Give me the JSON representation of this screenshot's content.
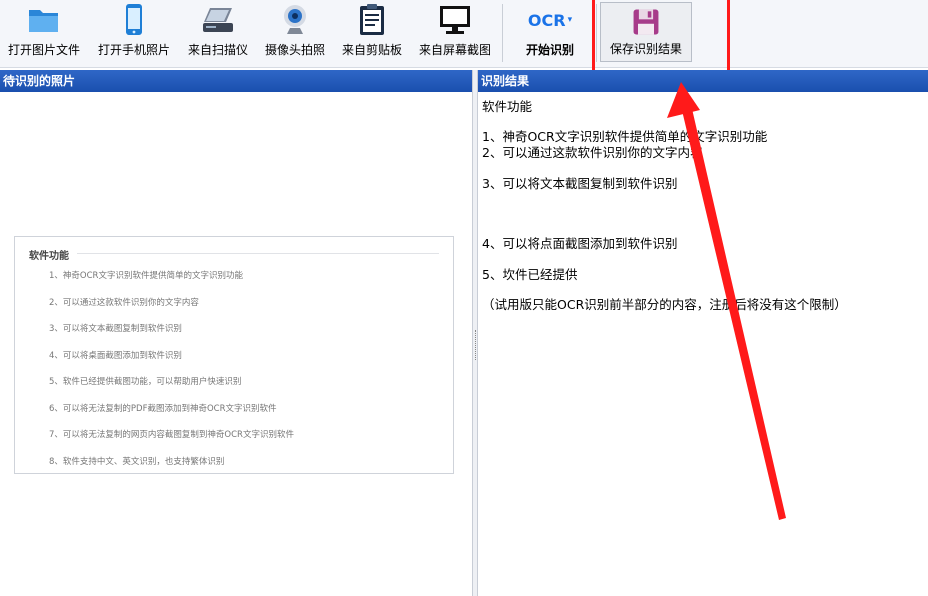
{
  "toolbar": {
    "buttons": [
      {
        "label": "打开图片文件",
        "icon": "folder-icon"
      },
      {
        "label": "打开手机照片",
        "icon": "phone-icon"
      },
      {
        "label": "来自扫描仪",
        "icon": "scanner-icon"
      },
      {
        "label": "摄像头拍照",
        "icon": "webcam-icon"
      },
      {
        "label": "来自剪贴板",
        "icon": "clipboard-icon"
      },
      {
        "label": "来自屏幕截图",
        "icon": "monitor-icon"
      },
      {
        "label": "开始识别",
        "icon": "ocr-icon",
        "icon_text": "OCR"
      }
    ],
    "save_label": "保存识别结果"
  },
  "left_panel": {
    "title": "待识别的照片",
    "preview": {
      "title": "软件功能",
      "lines": [
        "1、神奇OCR文字识别软件提供简单的文字识别功能",
        "2、可以通过这款软件识别你的文字内容",
        "3、可以将文本截图复制到软件识别",
        "4、可以将桌面截图添加到软件识别",
        "5、软件已经提供截图功能，可以帮助用户快速识别",
        "6、可以将无法复制的PDF截图添加到神奇OCR文字识别软件",
        "7、可以将无法复制的网页内容截图复制到神奇OCR文字识别软件",
        "8、软件支持中文、英文识别，也支持繁体识别"
      ]
    }
  },
  "right_panel": {
    "title": "识别结果",
    "lines": [
      "软件功能",
      "1、神奇OCR文字识别软件提供简单的文字识别功能",
      "2、可以通过这款软件识别你的文字内容",
      "3、可以将文本截图复制到软件识别",
      "4、可以将点面截图添加到软件识别",
      "5、坎件已经提供",
      "（试用版只能OCR识别前半部分的内容，注册后将没有这个限制）"
    ]
  },
  "colors": {
    "header_blue": "#1f55b5",
    "highlight_red": "#ff1a1a",
    "ocr_blue": "#1a73e8"
  }
}
